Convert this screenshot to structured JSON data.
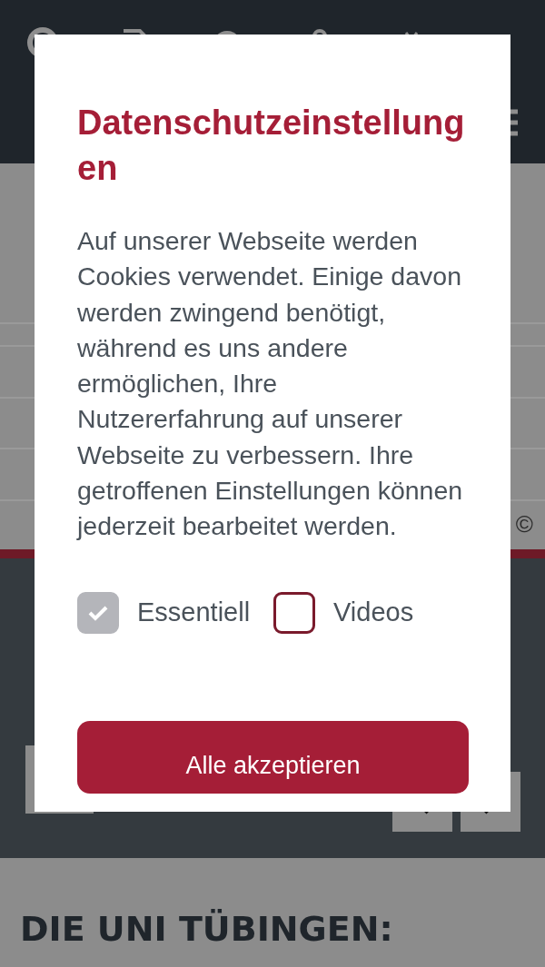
{
  "page": {
    "copyright": "©",
    "heading": "DIE UNI TÜBINGEN:"
  },
  "dialog": {
    "title": "Datenschutzeinstellungen",
    "text": "Auf unserer Webseite werden Cookies verwendet. Einige davon werden zwingend benötigt, während es uns andere ermöglichen, Ihre Nutzererfahrung auf unserer Webseite zu verbessern. Ihre getroffenen Einstellungen können jederzeit bearbeitet werden.",
    "options": [
      {
        "label": "Essentiell",
        "checked": true,
        "disabled": true
      },
      {
        "label": "Videos",
        "checked": false,
        "disabled": false
      }
    ],
    "button": "Alle akzeptieren"
  }
}
